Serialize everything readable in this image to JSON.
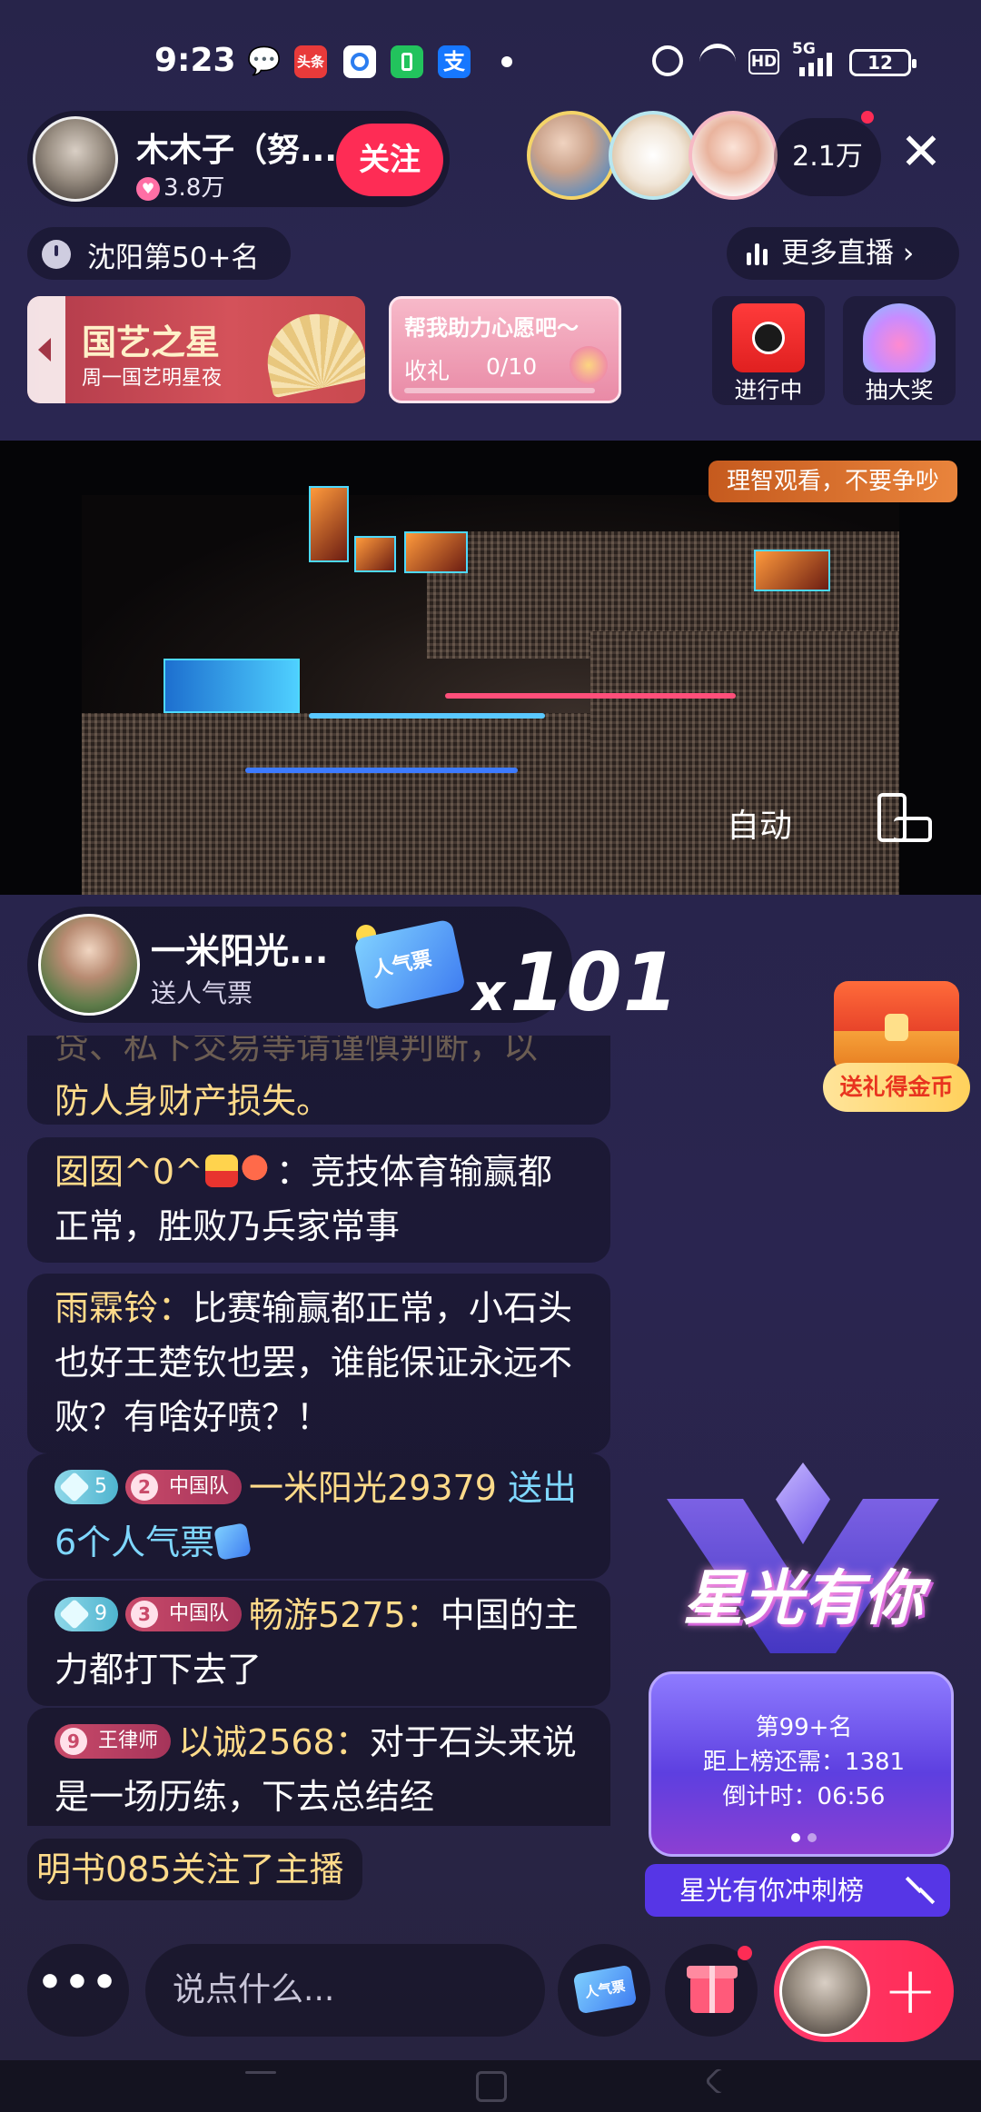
{
  "status_bar": {
    "time": "9:23",
    "apps": [
      "wechat-icon",
      "toutiao-icon",
      "browser-icon",
      "battery-app-icon",
      "alipay-icon"
    ],
    "toutiao_label": "头条",
    "alipay_label": "支",
    "network": "5G",
    "hd": "HD",
    "battery": "12"
  },
  "header": {
    "anchor_name": "木木子（努...",
    "anchor_likes": "3.8万",
    "follow_label": "关注",
    "viewer_count": "2.1万",
    "close_label": "✕",
    "rank_text": "沈阳第50+名",
    "more_live_label": "更多直播 ›"
  },
  "banners": {
    "event_title": "国艺之星",
    "event_sub": "周一国艺明星夜",
    "wish_title": "帮我助力心愿吧～",
    "wish_label": "收礼",
    "wish_value": "0/10",
    "wish_progress": 0,
    "activity_ongoing": "进行中",
    "activity_lottery": "抽大奖"
  },
  "video": {
    "tag": "理智观看，不要争吵",
    "auto_label": "自动"
  },
  "gift_notice": {
    "user": "一米阳光...",
    "action": "送人气票",
    "combo_x": "x",
    "combo_count": "101"
  },
  "treasure": {
    "label": "送礼得金币"
  },
  "chat": {
    "partial_top": "贷、私下交易等请谨慎判断，以",
    "partial_rest": "防人身财产损失。",
    "m1_nick": "囡囡^0^",
    "m1_text": "：竞技体育输赢都正常，胜败乃兵家常事",
    "m2_nick": "雨霖铃：",
    "m2_text": "比赛输赢都正常，小石头也好王楚钦也罢，谁能保证永远不败？有啥好喷？！",
    "m3_lv": "5",
    "m3_fan_lv": "2",
    "m3_fan": "中国队",
    "m3_user": "一米阳光29379",
    "m3_text": " 送出6个人气票",
    "m4_lv": "9",
    "m4_fan_lv": "3",
    "m4_fan": "中国队",
    "m4_nick": "畅游5275：",
    "m4_text": "中国的主力都打下去了",
    "m5_fan_lv": "9",
    "m5_fan": "王律师",
    "m5_nick": "以诚2568：",
    "m5_text": "对于石头来说是一场历练，下去总结经",
    "follow_notice": "明书085关注了主播"
  },
  "star": {
    "title": "星光有你",
    "rank": "第99+名",
    "gap": "距上榜还需：1381",
    "countdown": "倒计时：06:56",
    "sprint_label": "星光有你冲刺榜"
  },
  "bottom_bar": {
    "more_label": "•••",
    "input_placeholder": "说点什么...",
    "ticket_label": "人气票",
    "plus_label": "+"
  },
  "colors": {
    "accent": "#fe2c55",
    "nickname": "#ffdb8a",
    "gift_user": "#7fd7ff",
    "background": "#2a2650"
  }
}
